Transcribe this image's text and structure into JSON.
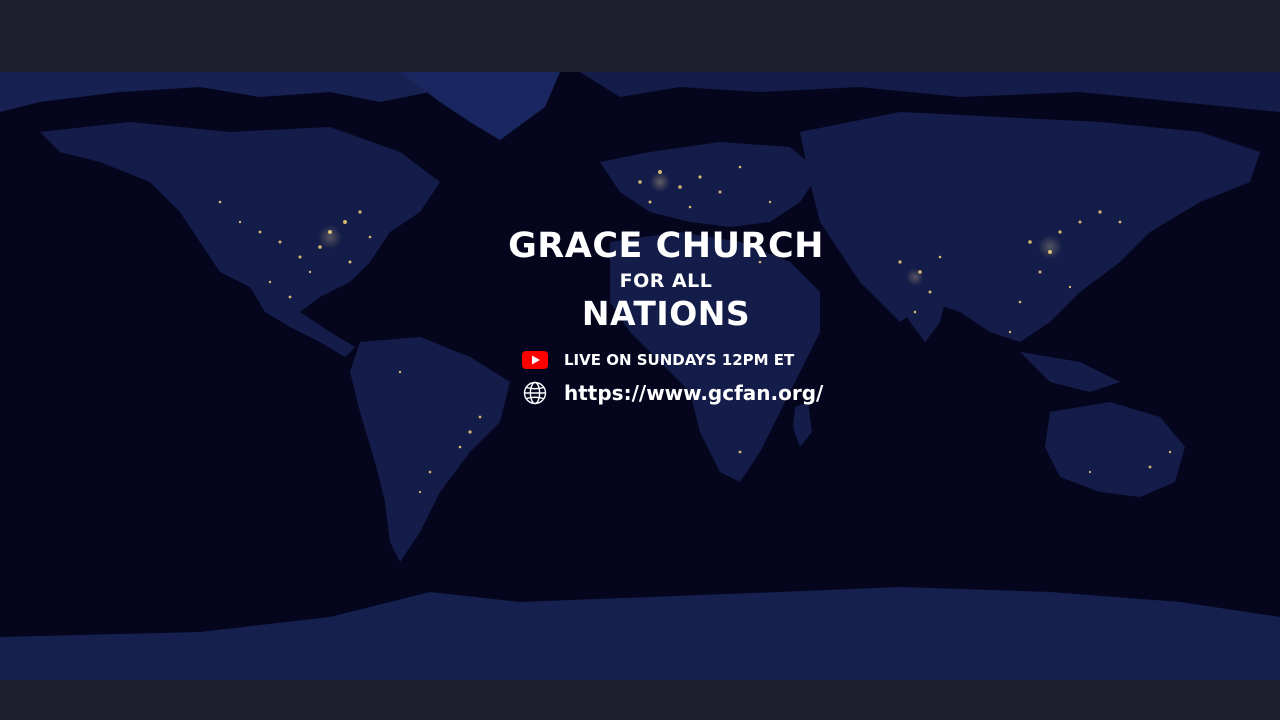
{
  "banner": {
    "title": "GRACE CHURCH",
    "subtitle": "FOR ALL",
    "title_second": "NATIONS",
    "stream": {
      "icon": "youtube-icon",
      "label": "LIVE ON SUNDAYS 12PM ET"
    },
    "website": {
      "icon": "globe-icon",
      "label": "https://www.gcfan.org/"
    }
  },
  "colors": {
    "letterbox": "#1e1f2e",
    "ocean": "#05061e",
    "land": "#16204f",
    "city_lights": "#f6d27a",
    "youtube_red": "#ff0000",
    "text": "#ffffff"
  }
}
